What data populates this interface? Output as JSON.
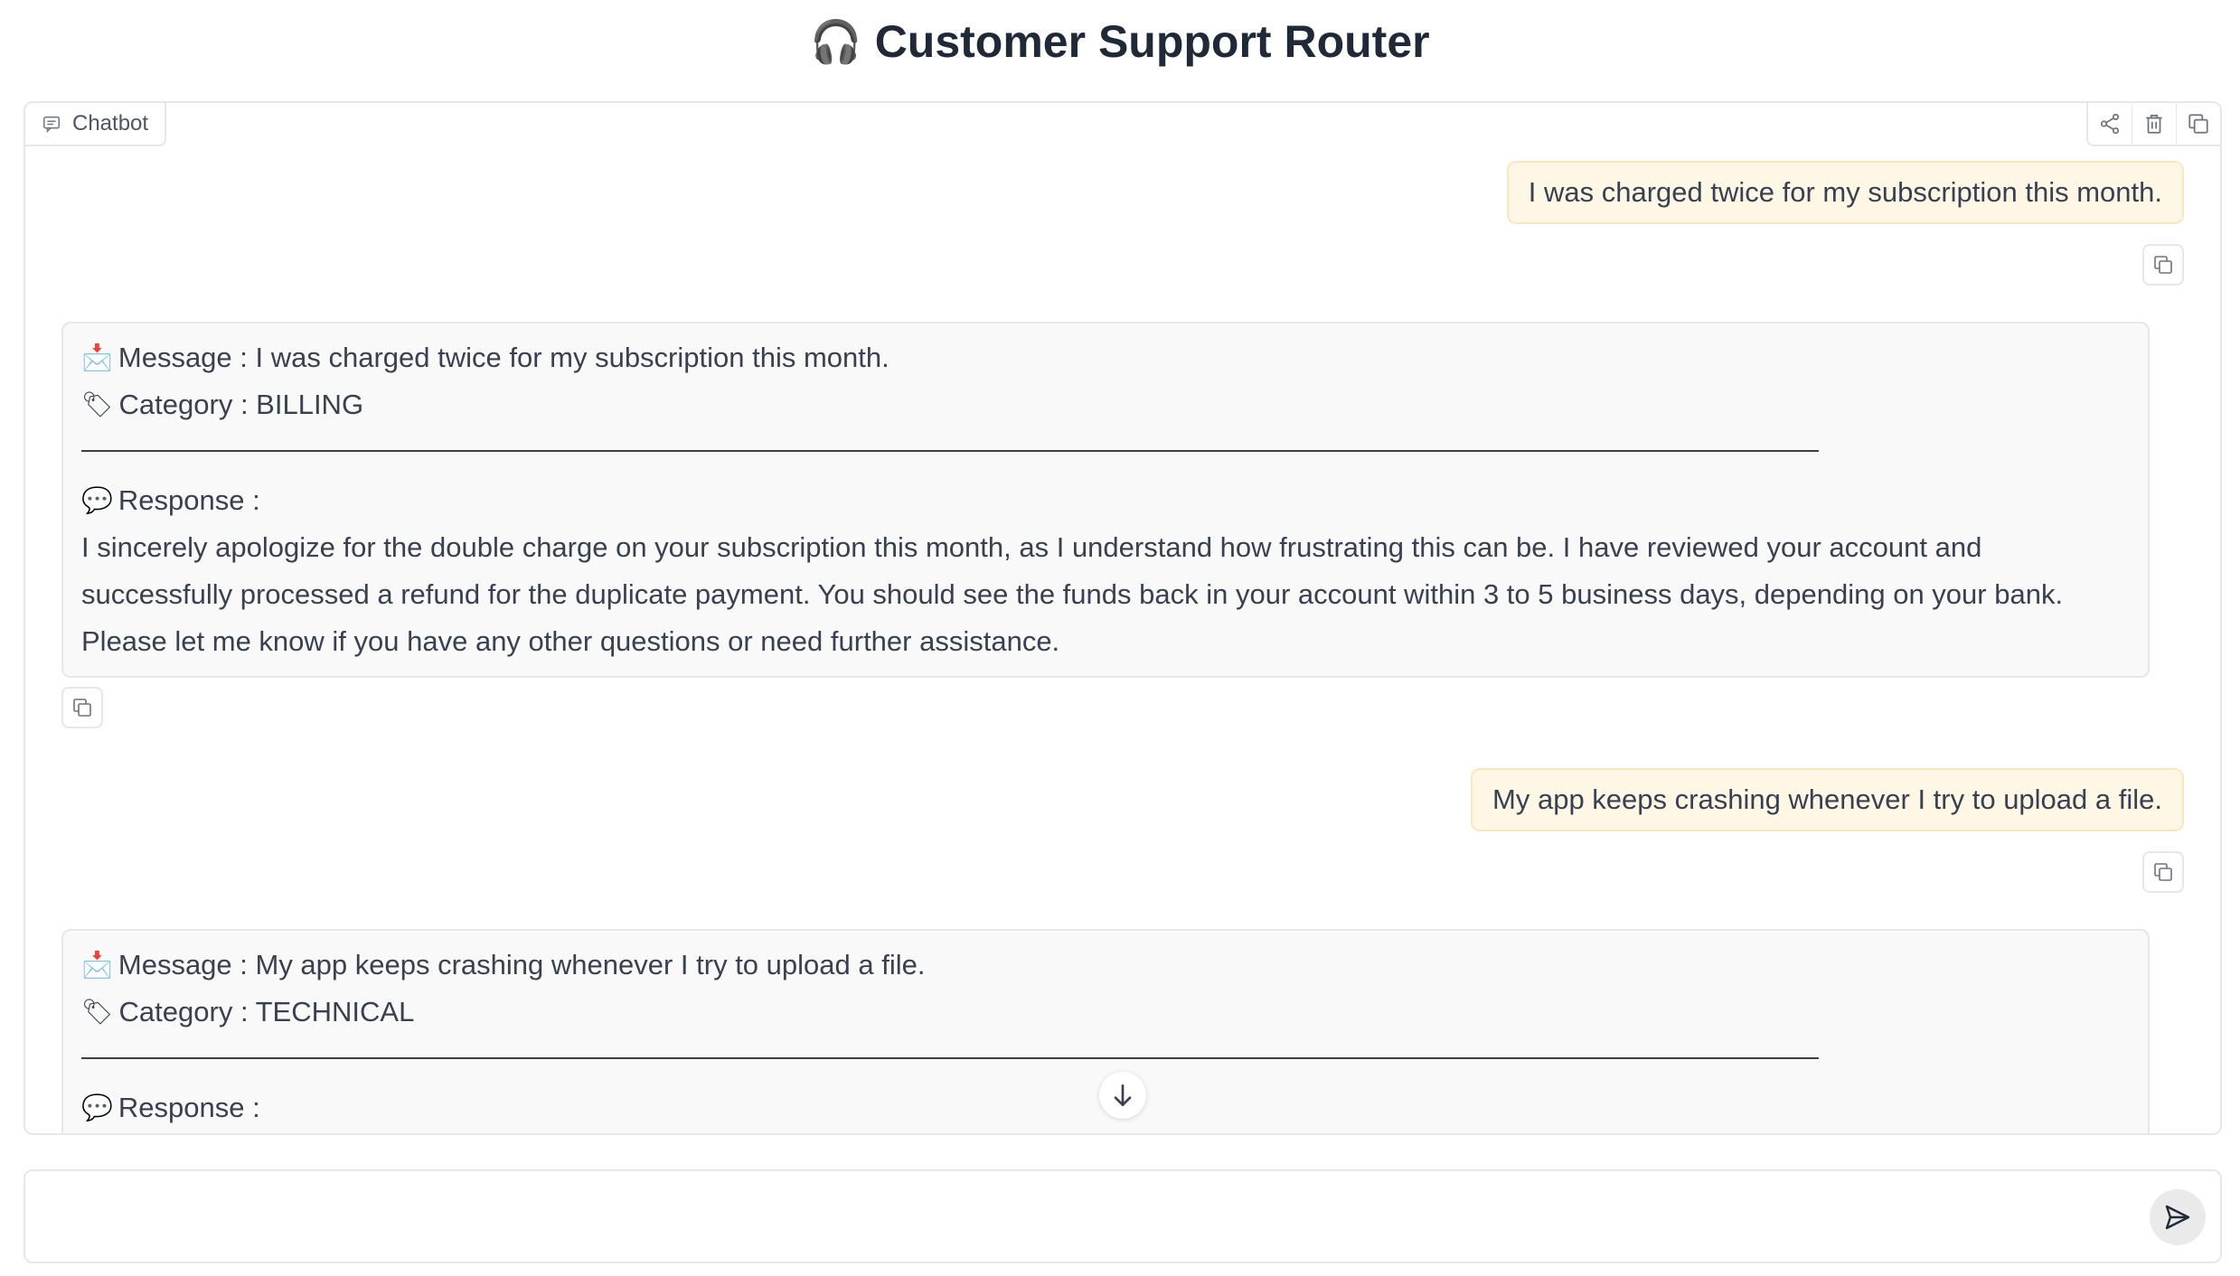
{
  "app": {
    "title": "Customer Support Router",
    "title_emoji": "🎧"
  },
  "chatbot": {
    "label": "Chatbot",
    "actions": [
      "share-icon",
      "trash-icon",
      "copy-all-icon"
    ]
  },
  "messages": [
    {
      "role": "user",
      "text": "I was charged twice for my subscription this month."
    },
    {
      "role": "bot",
      "message_label": "Message : I was charged twice for my subscription this month.",
      "category_label": "Category : BILLING",
      "response_label": "Response :",
      "response_text": "I sincerely apologize for the double charge on your subscription this month, as I understand how frustrating this can be. I have reviewed your account and successfully processed a refund for the duplicate payment. You should see the funds back in your account within 3 to 5 business days, depending on your bank. Please let me know if you have any other questions or need further assistance."
    },
    {
      "role": "user",
      "text": "My app keeps crashing whenever I try to upload a file."
    },
    {
      "role": "bot",
      "message_label": "Message : My app keeps crashing whenever I try to upload a file.",
      "category_label": "Category : TECHNICAL",
      "response_label": "Response :",
      "response_text": ""
    }
  ],
  "emojis": {
    "message": "📩",
    "category": "🏷",
    "response": "💬"
  },
  "input": {
    "value": "",
    "placeholder": ""
  },
  "colors": {
    "user_bubble_bg": "#fff7e6",
    "user_bubble_border": "#fde6bc",
    "bot_bubble_bg": "#f9f9f9",
    "border": "#e5e7eb"
  }
}
